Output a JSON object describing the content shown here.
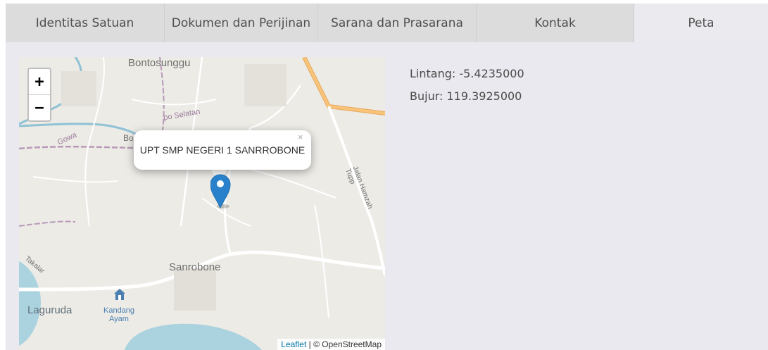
{
  "tabs": [
    {
      "label": "Identitas Satuan",
      "active": false
    },
    {
      "label": "Dokumen dan Perijinan",
      "active": false
    },
    {
      "label": "Sarana dan Prasarana",
      "active": false
    },
    {
      "label": "Kontak",
      "active": false
    },
    {
      "label": "Peta",
      "active": true
    }
  ],
  "map": {
    "zoom_in": "+",
    "zoom_out": "−",
    "popup_text": "UPT SMP NEGERI 1 SANRROBONE",
    "popup_close": "×",
    "labels": {
      "bontosunggu": "Bontosunggu",
      "sanrobone": "Sanrobone",
      "laguruda": "Laguruda",
      "kandang_ayam_1": "Kandang",
      "kandang_ayam_2": "Ayam",
      "gowa": "Gowa",
      "bo": "Bo",
      "selatan": "po Selatan",
      "jalan": "Jalan Hamzah Tupp",
      "takalar": "Takalar"
    },
    "attribution_link": "Leaflet",
    "attribution_text": " | © OpenStreetMap",
    "marker_color": "#2a81cb",
    "water_color": "#aad3df",
    "road_color": "#f7c47a"
  },
  "location": {
    "latitude": "Lintang: -5.4235000",
    "longitude": "Bujur: 119.3925000"
  }
}
